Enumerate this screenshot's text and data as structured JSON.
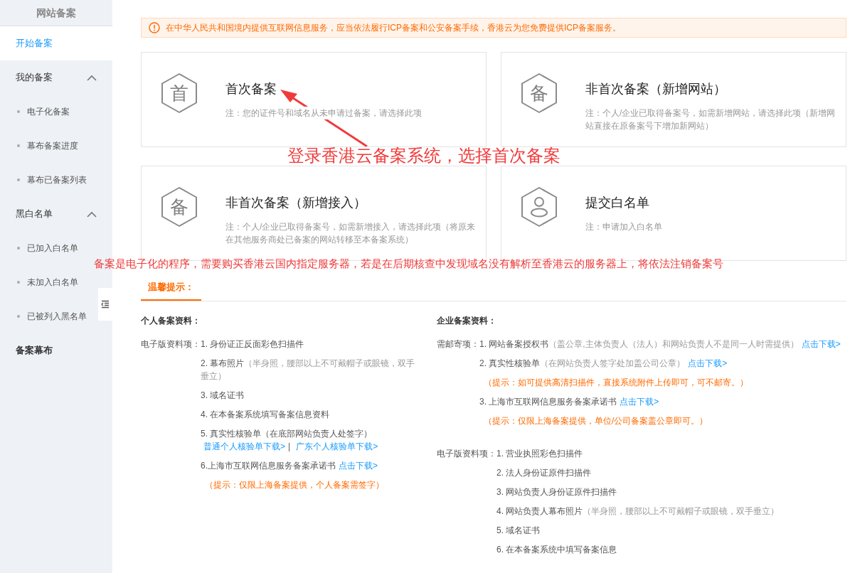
{
  "sidebar": {
    "title": "网站备案",
    "items": [
      {
        "kind": "link",
        "label": "开始备案",
        "selected": true
      },
      {
        "kind": "group",
        "label": "我的备案",
        "expanded": true,
        "children": [
          {
            "label": "电子化备案",
            "selected": false
          },
          {
            "label": "幕布备案进度",
            "selected": false
          },
          {
            "label": "幕布已备案列表",
            "selected": false
          }
        ]
      },
      {
        "kind": "group",
        "label": "黑白名单",
        "expanded": true,
        "children": [
          {
            "label": "已加入白名单",
            "selected": false
          },
          {
            "label": "未加入白名单",
            "selected": false
          },
          {
            "label": "已被列入黑名单",
            "selected": false
          }
        ]
      },
      {
        "kind": "link",
        "label": "备案幕布",
        "selected": false
      }
    ]
  },
  "notice": {
    "text": "在中华人民共和国境内提供互联网信息服务，应当依法履行ICP备案和公安备案手续，香港云为您免费提供ICP备案服务。"
  },
  "cards": [
    {
      "kind": "glyph",
      "glyph": "首",
      "title": "首次备案",
      "note": "注：您的证件号和域名从未申请过备案，请选择此项"
    },
    {
      "kind": "glyph",
      "glyph": "备",
      "title": "非首次备案（新增网站）",
      "note": "注：个人/企业已取得备案号，如需新增网站，请选择此项（新增网站直接在原备案号下增加新网站）"
    },
    {
      "kind": "glyph",
      "glyph": "备",
      "title": "非首次备案（新增接入）",
      "note": "注：个人/企业已取得备案号，如需新增接入，请选择此项（将原来在其他服务商处已备案的网站转移至本备案系统）"
    },
    {
      "kind": "person",
      "title": "提交白名单",
      "note": "注：申请加入白名单"
    }
  ],
  "annotations": {
    "heading": "登录香港云备案系统，选择首次备案",
    "remark": "备案是电子化的程序，需要购买香港云国内指定服务器，若是在后期核查中发现域名没有解析至香港云的服务器上，将依法注销备案号"
  },
  "tabs": [
    {
      "label": "温馨提示：",
      "selected": true
    }
  ],
  "sections": [
    {
      "title": "个人备案资料：",
      "groups": [
        {
          "label": "电子版资料项：",
          "items": [
            {
              "kind": "item",
              "lines": [
                [
                  {
                    "kind": "text",
                    "text": "1. 身份证正反面彩色扫描件"
                  }
                ]
              ]
            },
            {
              "kind": "item",
              "lines": [
                [
                  {
                    "kind": "text",
                    "text": "2. 幕布照片"
                  },
                  {
                    "kind": "note",
                    "text": "（半身照，腰部以上不可戴帽子或眼镜，双手垂立）"
                  }
                ]
              ]
            },
            {
              "kind": "item",
              "lines": [
                [
                  {
                    "kind": "text",
                    "text": "3. 域名证书"
                  }
                ]
              ]
            },
            {
              "kind": "item",
              "lines": [
                [
                  {
                    "kind": "text",
                    "text": "4. 在本备案系统填写备案信息资料"
                  }
                ]
              ]
            },
            {
              "kind": "item",
              "lines": [
                [
                  {
                    "kind": "text",
                    "text": "5. 真实性核验单（在底部网站负责人处签字）"
                  }
                ],
                [
                  {
                    "kind": "link",
                    "text": "普通个人核验单下载>"
                  },
                  {
                    "kind": "sep",
                    "text": "|"
                  },
                  {
                    "kind": "link",
                    "text": "广东个人核验单下载>"
                  }
                ]
              ]
            },
            {
              "kind": "item",
              "lines": [
                [
                  {
                    "kind": "text",
                    "text": "6.上海市互联网信息服务备案承诺书"
                  },
                  {
                    "kind": "link",
                    "text": "点击下载>"
                  }
                ]
              ]
            },
            {
              "kind": "hint",
              "text": "（提示：仅限上海备案提供，个人备案需签字）"
            }
          ]
        }
      ]
    },
    {
      "title": "企业备案资料：",
      "groups": [
        {
          "label": "需邮寄项：",
          "items": [
            {
              "kind": "item",
              "lines": [
                [
                  {
                    "kind": "text",
                    "text": "1. 网站备案授权书"
                  },
                  {
                    "kind": "note",
                    "text": "（盖公章,主体负责人（法人）和网站负责人不是同一人时需提供）"
                  },
                  {
                    "kind": "link",
                    "text": "点击下载>"
                  }
                ]
              ]
            },
            {
              "kind": "item",
              "lines": [
                [
                  {
                    "kind": "text",
                    "text": "2. 真实性核验单"
                  },
                  {
                    "kind": "note",
                    "text": "（在网站负责人签字处加盖公司公章）"
                  },
                  {
                    "kind": "link",
                    "text": "点击下载>"
                  }
                ]
              ]
            },
            {
              "kind": "hint",
              "text": "（提示：如可提供高清扫描件，直接系统附件上传即可，可不邮寄。）"
            },
            {
              "kind": "item",
              "lines": [
                [
                  {
                    "kind": "text",
                    "text": "3. 上海市互联网信息服务备案承诺书"
                  },
                  {
                    "kind": "link",
                    "text": "点击下载>"
                  }
                ]
              ]
            },
            {
              "kind": "hint",
              "text": "（提示：仅限上海备案提供，单位/公司备案盖公章即可。）"
            }
          ]
        },
        {
          "label": "电子版资料项：",
          "items": [
            {
              "kind": "item",
              "lines": [
                [
                  {
                    "kind": "text",
                    "text": "1. 营业执照彩色扫描件"
                  }
                ]
              ]
            },
            {
              "kind": "item",
              "lines": [
                [
                  {
                    "kind": "text",
                    "text": "2. 法人身份证原件扫描件"
                  }
                ]
              ]
            },
            {
              "kind": "item",
              "lines": [
                [
                  {
                    "kind": "text",
                    "text": "3. 网站负责人身份证原件扫描件"
                  }
                ]
              ]
            },
            {
              "kind": "item",
              "lines": [
                [
                  {
                    "kind": "text",
                    "text": "4. 网站负责人幕布照片"
                  },
                  {
                    "kind": "note",
                    "text": "（半身照，腰部以上不可戴帽子或眼镜，双手垂立）"
                  }
                ]
              ]
            },
            {
              "kind": "item",
              "lines": [
                [
                  {
                    "kind": "text",
                    "text": "5. 域名证书"
                  }
                ]
              ]
            },
            {
              "kind": "item",
              "lines": [
                [
                  {
                    "kind": "text",
                    "text": "6. 在本备案系统中填写备案信息"
                  }
                ]
              ]
            }
          ]
        }
      ]
    }
  ]
}
